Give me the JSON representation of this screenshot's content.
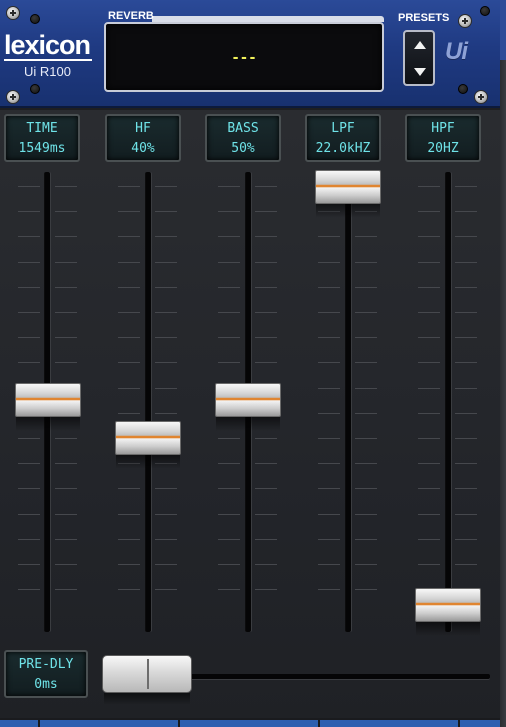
{
  "brand": {
    "logo": "lexicon",
    "model": "Ui R100",
    "ui_mark": "Ui"
  },
  "reverb": {
    "label": "REVERB",
    "display": "---"
  },
  "presets": {
    "label": "PRESETS",
    "up_icon": "triangle-up-icon",
    "down_icon": "triangle-down-icon"
  },
  "channels": [
    {
      "label": "TIME",
      "value": "1549ms",
      "level": 0.49
    },
    {
      "label": "HF",
      "value": "40%",
      "level": 0.4
    },
    {
      "label": "BASS",
      "value": "50%",
      "level": 0.49
    },
    {
      "label": "LPF",
      "value": "22.0kHZ",
      "level": 1.0
    },
    {
      "label": "HPF",
      "value": "20HZ",
      "level": 0.0
    }
  ],
  "predelay": {
    "label": "PRE-DLY",
    "value": "0ms",
    "level": 0.0
  },
  "colors": {
    "header": "#1f3a82",
    "lcd_text": "#6fe3e8",
    "display_text": "#f2f25a",
    "fader_stripe": "#e08530"
  }
}
